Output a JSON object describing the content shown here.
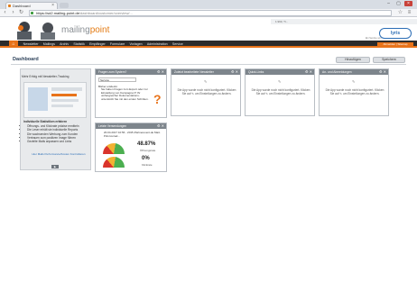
{
  "browser": {
    "tab_title": "Dashboard",
    "close_glyph": "×",
    "url_host": "https://sd2.mailing-point.de",
    "url_path": "/dashboard/customer/overview/...",
    "window_buttons": [
      "–",
      "▢",
      "×"
    ],
    "nav_icons": [
      "arrow-left-icon",
      "arrow-right-icon",
      "reload-icon"
    ]
  },
  "header": {
    "logo_text_1": "mailing",
    "logo_text_2": "point",
    "account_line": "1.990, Tr...",
    "partner_badge": "lyris",
    "partner_note": "Ein Service von"
  },
  "menu": {
    "items": [
      "Newsletter",
      "Mailings",
      "Archiv",
      "Statistik",
      "Empfänger",
      "Formulare",
      "Vorlagen",
      "Administration",
      "Service"
    ],
    "right_button": "Abmelden | Sitemap"
  },
  "dashboard": {
    "title": "Dashboard",
    "btn_left": "Hinzufügen",
    "btn_right": "Speichern"
  },
  "promo": {
    "headline": "Mehr Erfolg mit Newsletter-Tracking",
    "list_title": "Individuelle Statistiken erfahren",
    "list_items": [
      "Öffnungs- und Klickrate präzise ermitteln",
      "Die Leser erhält sie individuelle Reports",
      "Die wachsenden Werbung zum Kunden",
      "Vertrauen zum positiven Image führen",
      "Gezielte Mails anpassen und Links"
    ],
    "link": "Hier Mails Performance/Kosten Kontrollieren"
  },
  "widgets": {
    "umfrage": {
      "title": "Fragen zum System?",
      "select": "Service",
      "q1": "Bisher entdeckt",
      "q2": "Sie haben Fragen zum Export oder zur Einstellung von Kampagnen? Ihr umfangreicher Dokumentations-unterstützt Sie mit den ersten Schritten."
    },
    "dyn1": {
      "title": "Zuletzt bearbeitete Newsletter",
      "msg": "Die App wurde noch nicht konfiguriert. Klicken Sie auf ✎ um Einstellungen zu ändern."
    },
    "dyn2": {
      "title": "Quick-Links",
      "msg": "Die App wurde noch nicht konfiguriert. Klicken Sie auf ✎ um Einstellungen zu ändern."
    },
    "dyn3": {
      "title": "An- und Abmeldungen",
      "msg": "Die App wurde noch nicht konfiguriert. Klicken Sie auf ✎ um Einstellungen zu ändern."
    },
    "stats": {
      "title": "Letzte Versendungen",
      "mailing": "20.04.2017 10:56 - 2015-Partnerevent-de Mail-Pdt-Conrad...",
      "open_rate": "48.87%",
      "open_label": "Öffnungsrate",
      "click_rate": "0%",
      "click_label": "Klickrate"
    },
    "controls": "⚙ ✕"
  },
  "colors": {
    "accent": "#e8731a",
    "menu_bg": "#2c2c2c",
    "widget_head": "#7d858c"
  }
}
